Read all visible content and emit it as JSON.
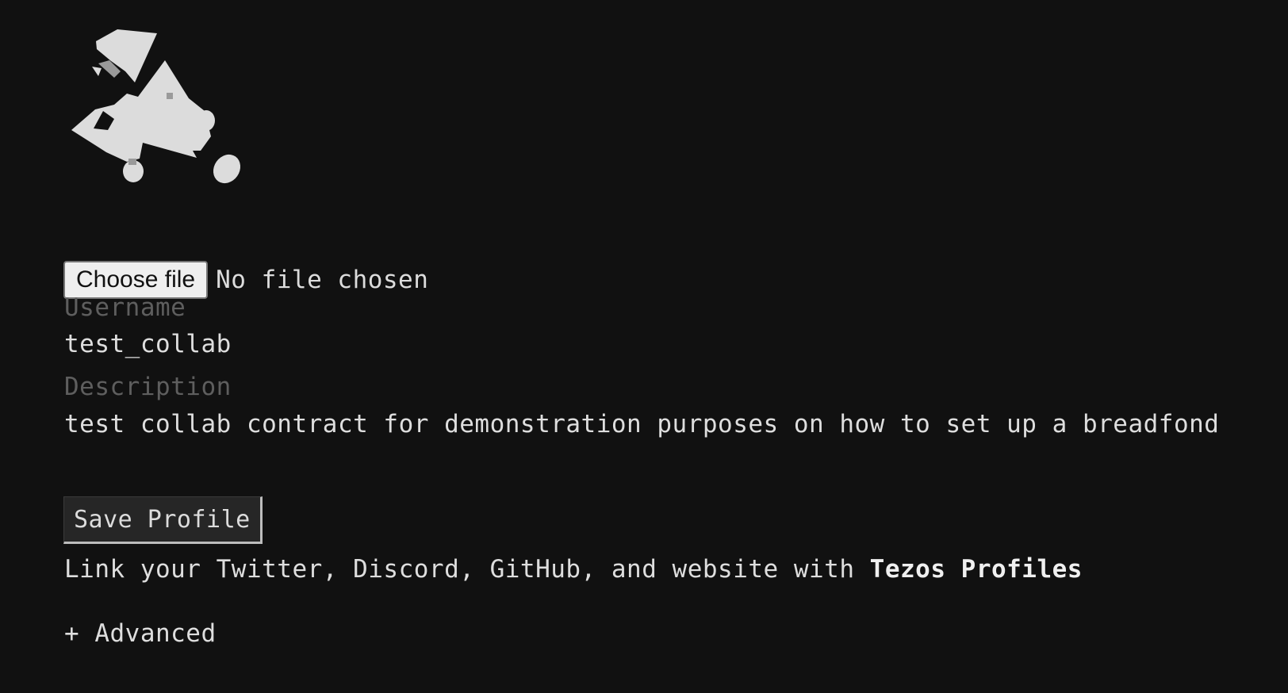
{
  "avatar": {
    "icon": "generative-abstract-avatar",
    "color": "#dcdcdc"
  },
  "file_input": {
    "button_label": "Choose file",
    "status": "No file chosen"
  },
  "username": {
    "label": "Username",
    "value": "test_collab"
  },
  "description": {
    "label": "Description",
    "value": "test collab contract for demonstration purposes on how to set up a breadfond"
  },
  "save_button": {
    "label": "Save Profile"
  },
  "profiles": {
    "prefix": "Link your Twitter, Discord, GitHub, and website with ",
    "link_text": "Tezos Profiles"
  },
  "advanced": {
    "label": "+ Advanced"
  }
}
